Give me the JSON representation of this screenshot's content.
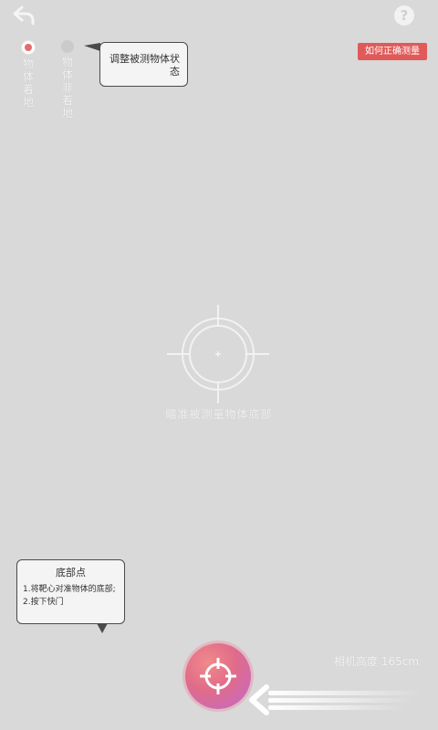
{
  "header": {
    "back_icon": "back-arrow-icon",
    "help_icon": "question-mark-icon",
    "help_glyph": "?"
  },
  "modes": [
    {
      "label": "物体着地",
      "selected": true
    },
    {
      "label": "物体非着地",
      "selected": false
    }
  ],
  "tooltip_top": {
    "text": "调整被测物体状态"
  },
  "howto_button": {
    "label": "如何正确测量"
  },
  "crosshair": {
    "hint": "瞄准被测量物体底部"
  },
  "tooltip_bottom": {
    "title": "底部点",
    "lines": [
      "1.将靶心对准物体的底部;",
      "2.按下快门"
    ]
  },
  "camera_height": {
    "text": "相机高度 165cm"
  },
  "colors": {
    "accent": "#e05a5a",
    "background": "#d9d9d9"
  }
}
